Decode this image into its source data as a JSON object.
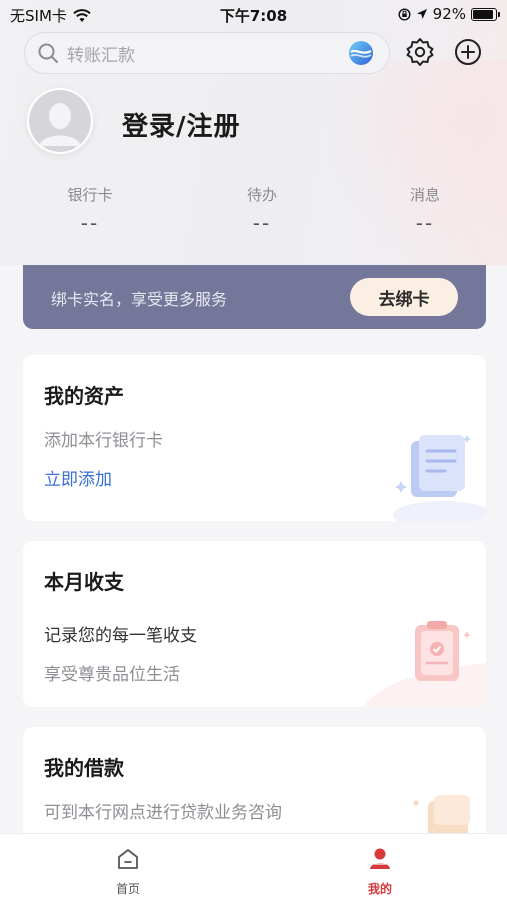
{
  "status_bar": {
    "carrier": "无SIM卡",
    "time": "下午7:08",
    "battery": "92%",
    "battery_level": 0.92
  },
  "search": {
    "placeholder": "转账汇款"
  },
  "profile": {
    "login_label": "登录/注册"
  },
  "stats": [
    {
      "label": "银行卡",
      "value": "--"
    },
    {
      "label": "待办",
      "value": "--"
    },
    {
      "label": "消息",
      "value": "--"
    }
  ],
  "bind_banner": {
    "text": "绑卡实名，享受更多服务",
    "button": "去绑卡"
  },
  "cards": {
    "assets": {
      "title": "我的资产",
      "line1": "添加本行银行卡",
      "link": "立即添加"
    },
    "monthly": {
      "title": "本月收支",
      "line1": "记录您的每一笔收支",
      "line2": "享受尊贵品位生活"
    },
    "loans": {
      "title": "我的借款",
      "line1": "可到本行网点进行贷款业务咨询"
    }
  },
  "tabs": [
    {
      "label": "首页",
      "active": false
    },
    {
      "label": "我的",
      "active": true
    }
  ],
  "colors": {
    "accent_red": "#d8393b",
    "banner_bg": "#74769a",
    "link_blue": "#3b6fd6"
  }
}
